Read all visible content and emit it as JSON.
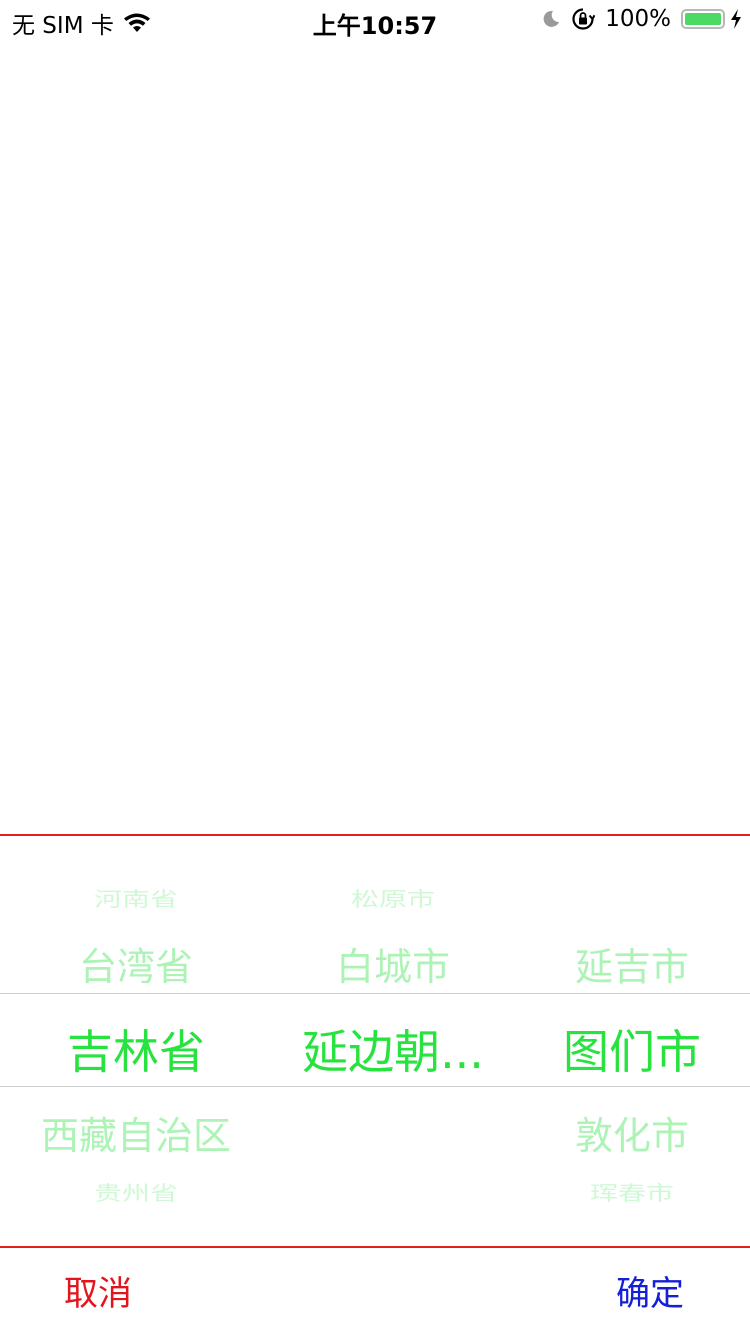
{
  "status_bar": {
    "carrier": "无 SIM 卡",
    "time": "上午10:57",
    "battery_percent": "100%",
    "battery_level": 1.0,
    "icons": [
      "wifi-icon",
      "moon-icon",
      "orientation-lock-icon",
      "battery-icon",
      "charging-icon"
    ]
  },
  "picker": {
    "province": {
      "above2": "河南省",
      "above1": "台湾省",
      "selected": "吉林省",
      "below1": "西藏自治区",
      "below2": "贵州省"
    },
    "city": {
      "above2": "松原市",
      "above1": "白城市",
      "selected": "延边朝...",
      "below1": "",
      "below2": ""
    },
    "district": {
      "above2": "",
      "above1": "延吉市",
      "selected": "图们市",
      "below1": "敦化市",
      "below2": "珲春市"
    },
    "colors": {
      "text": "#28e23f",
      "border": "#e0201d",
      "divider": "#cfcfcf"
    }
  },
  "footer": {
    "cancel_label": "取消",
    "confirm_label": "确定",
    "cancel_color": "#e2141c",
    "confirm_color": "#1320d8"
  }
}
